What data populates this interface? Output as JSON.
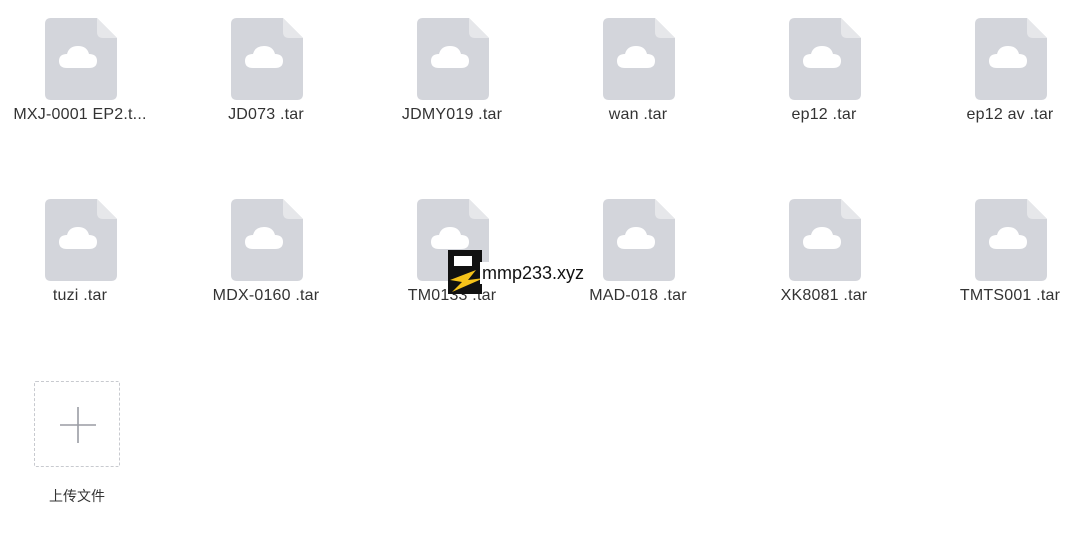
{
  "files": [
    {
      "name": "MXJ-0001 EP2.t...",
      "icon": "cloud-file-icon"
    },
    {
      "name": "JD073 .tar",
      "icon": "cloud-file-icon"
    },
    {
      "name": "JDMY019 .tar",
      "icon": "cloud-file-icon"
    },
    {
      "name": "wan .tar",
      "icon": "cloud-file-icon"
    },
    {
      "name": "ep12 .tar",
      "icon": "cloud-file-icon"
    },
    {
      "name": "ep12 av .tar",
      "icon": "cloud-file-icon"
    },
    {
      "name": "tuzi .tar",
      "icon": "cloud-file-icon"
    },
    {
      "name": "MDX-0160 .tar",
      "icon": "cloud-file-icon"
    },
    {
      "name": "TM0133 .tar",
      "icon": "cloud-file-icon"
    },
    {
      "name": "MAD-018 .tar",
      "icon": "cloud-file-icon"
    },
    {
      "name": "XK8081 .tar",
      "icon": "cloud-file-icon"
    },
    {
      "name": "TMTS001 .tar",
      "icon": "cloud-file-icon"
    }
  ],
  "upload": {
    "label": "上传文件",
    "icon": "plus-icon"
  },
  "watermark": {
    "text": "mmp233.xyz"
  },
  "colors": {
    "icon_fill": "#d3d5db",
    "icon_fold": "#e6e7ea",
    "text": "#333333",
    "dashed_border": "#c8cacf"
  }
}
